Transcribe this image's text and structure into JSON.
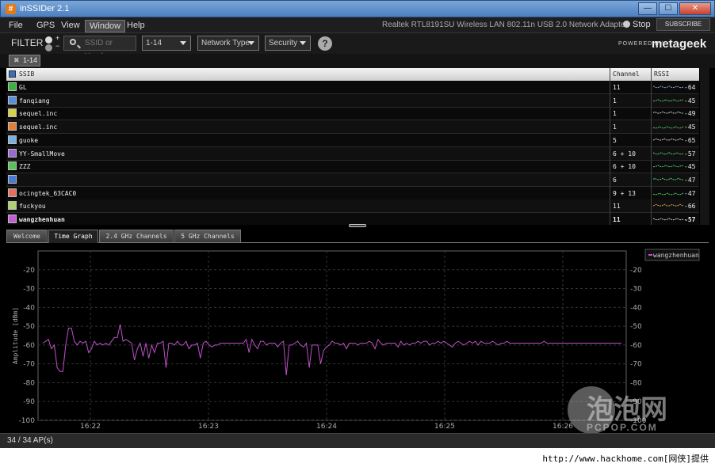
{
  "window": {
    "title": "inSSIDer 2.1",
    "minimize": "—",
    "maximize": "☐",
    "close": "✕"
  },
  "menu": {
    "items": [
      "File",
      "GPS",
      "View",
      "Window",
      "Help"
    ]
  },
  "adapter_name": "Realtek RTL8191SU Wireless LAN 802.11n USB 2.0 Network Adapter",
  "stop_label": "Stop",
  "subscribe_label": "SUBSCRIBE",
  "filter": {
    "label": "FILTER",
    "plus": "+",
    "minus": "−",
    "search_placeholder": "SSID or Vendor",
    "channel_value": "1-14",
    "network_type_label": "Network Type",
    "security_label": "Security",
    "help": "?"
  },
  "powered_by": "POWERED BY",
  "brand": "metageek",
  "active_tag": {
    "close": "✖",
    "label": "1-14"
  },
  "table": {
    "headers": {
      "ssid": "SSIB",
      "channel": "Channel",
      "rssi": "RSSI"
    },
    "rows": [
      {
        "ssid": "GL",
        "channel": "11",
        "rssi": "-64",
        "color": "#3cb043",
        "spark": "#8aa6c8"
      },
      {
        "ssid": "fanqiang",
        "channel": "1",
        "rssi": "-45",
        "color": "#5a8fd6",
        "spark": "#54d06a"
      },
      {
        "ssid": "sequel.inc",
        "channel": "1",
        "rssi": "-49",
        "color": "#d8d04a",
        "spark": "#d0d0d0"
      },
      {
        "ssid": "sequel.inc",
        "channel": "1",
        "rssi": "-45",
        "color": "#e0803a",
        "spark": "#54d06a"
      },
      {
        "ssid": "guoke",
        "channel": "5",
        "rssi": "-65",
        "color": "#7ab0e0",
        "spark": "#d0d0d0"
      },
      {
        "ssid": "YY-SmallMove",
        "channel": "6 + 10",
        "rssi": "-57",
        "color": "#9a6ad0",
        "spark": "#54d06a"
      },
      {
        "ssid": "ZZZ",
        "channel": "6 + 10",
        "rssi": "-45",
        "color": "#5ac05a",
        "spark": "#54d06a"
      },
      {
        "ssid": "",
        "channel": "6",
        "rssi": "-47",
        "color": "#4a7ad0",
        "spark": "#54d06a"
      },
      {
        "ssid": "ocingtek_63CAC0",
        "channel": "9 + 13",
        "rssi": "-47",
        "color": "#e07060",
        "spark": "#54d06a"
      },
      {
        "ssid": "fuckyou",
        "channel": "11",
        "rssi": "-66",
        "color": "#b0d070",
        "spark": "#e0a050"
      },
      {
        "ssid": "wangzhenhuan",
        "channel": "11",
        "rssi": "-57",
        "color": "#c060d0",
        "spark": "#d0d0d0"
      }
    ]
  },
  "tabs": [
    "Welcome",
    "Time Graph",
    "2.4 GHz Channels",
    "5 GHz Channels"
  ],
  "active_tab": "Time Graph",
  "chart_data": {
    "type": "line",
    "ylabel": "Amplitude [dBm]",
    "ylim": [
      -100,
      -10
    ],
    "y_ticks": [
      -20,
      -30,
      -40,
      -50,
      -60,
      -70,
      -80,
      -90,
      -100
    ],
    "x_ticks": [
      "16:22",
      "16:23",
      "16:24",
      "16:25",
      "16:26"
    ],
    "grid": true,
    "legend_placement": "top-right",
    "series": [
      {
        "name": "wangzhenhuan",
        "color": "#c050c8",
        "values": [
          -59,
          -58,
          -57,
          -62,
          -60,
          -72,
          -74,
          -74,
          -60,
          -51,
          -51,
          -58,
          -60,
          -58,
          -59,
          -58,
          -64,
          -62,
          -58,
          -60,
          -59,
          -60,
          -59,
          -60,
          -58,
          -56,
          -56,
          -49,
          -58,
          -57,
          -58,
          -59,
          -68,
          -62,
          -59,
          -66,
          -59,
          -67,
          -60,
          -64,
          -59,
          -59,
          -58,
          -72,
          -59,
          -59,
          -60,
          -58,
          -60,
          -60,
          -58,
          -62,
          -60,
          -60,
          -59,
          -67,
          -59,
          -58,
          -60,
          -61,
          -60,
          -60,
          -59,
          -59,
          -59,
          -59,
          -59,
          -59,
          -59,
          -59,
          -59,
          -57,
          -64,
          -57,
          -60,
          -62,
          -58,
          -58,
          -60,
          -59,
          -59,
          -59,
          -61,
          -59,
          -58,
          -76,
          -60,
          -60,
          -59,
          -58,
          -60,
          -61,
          -59,
          -72,
          -60,
          -60,
          -60,
          -70,
          -63,
          -61,
          -60,
          -58,
          -59,
          -59,
          -60,
          -59,
          -62,
          -59,
          -59,
          -59,
          -60,
          -59,
          -59,
          -59,
          -58,
          -59,
          -62,
          -57,
          -59,
          -60,
          -59,
          -59,
          -59,
          -59,
          -61,
          -58,
          -60,
          -59,
          -60,
          -59,
          -59,
          -58,
          -59,
          -58,
          -58,
          -60,
          -59,
          -59,
          -58,
          -59,
          -58,
          -59,
          -60,
          -61,
          -59,
          -58,
          -59,
          -60,
          -59,
          -58,
          -59,
          -58,
          -60,
          -58,
          -59,
          -59,
          -59,
          -58,
          -59,
          -60,
          -59,
          -59,
          -58,
          -59,
          -59,
          -59,
          -59,
          -59,
          -59,
          -59,
          -59,
          -59,
          -59,
          -59,
          -59,
          -58,
          -59,
          -59,
          -59,
          -59,
          -59,
          -59,
          -59,
          -59,
          -59,
          -59,
          -59,
          -59,
          -59,
          -59,
          -59,
          -59,
          -59,
          -59,
          -59,
          -59,
          -59,
          -59,
          -59,
          -59,
          -59,
          -59,
          -59
        ]
      }
    ]
  },
  "status": "34 / 34 AP(s)",
  "watermark": {
    "cn": "泡泡网",
    "en": "PCPOP.COM",
    "url": "http://www.hackhome.com[网侠]提供"
  }
}
